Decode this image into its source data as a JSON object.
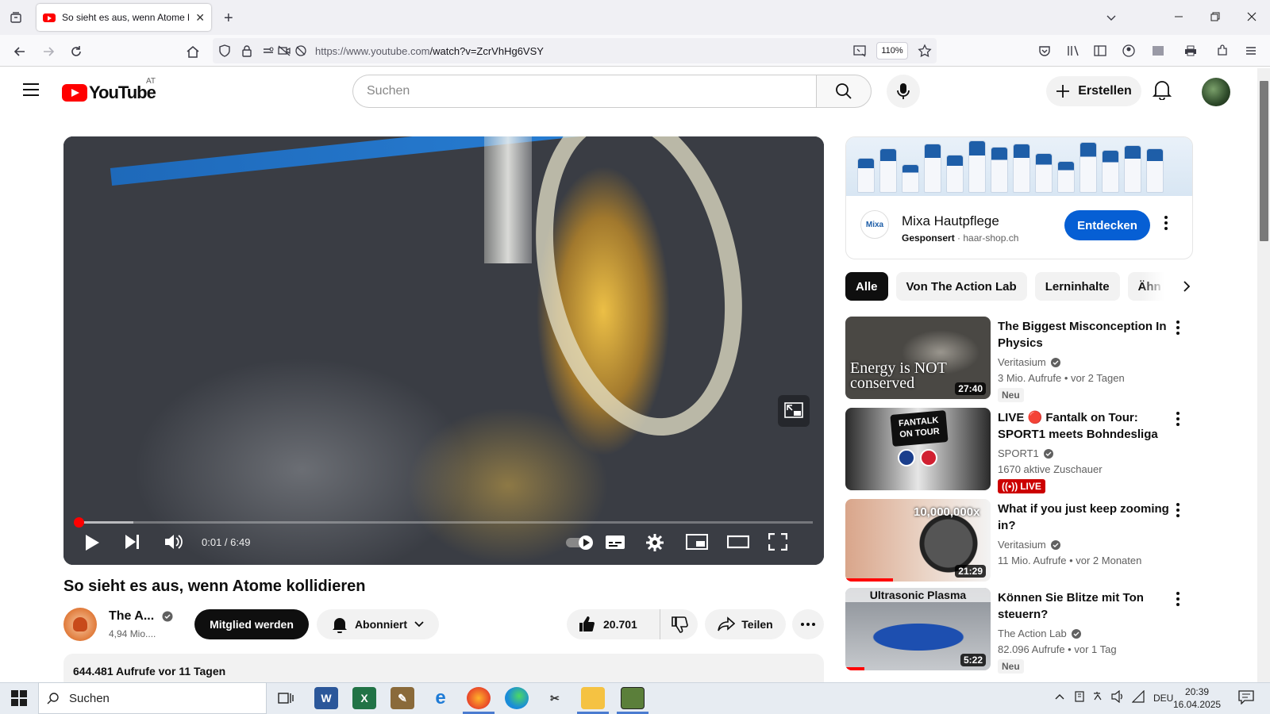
{
  "browser": {
    "tab_title": "So sieht es aus, wenn Atome ko",
    "url_host": "https://www.youtube.com",
    "url_path": "/watch?v=ZcrVhHg6VSY",
    "zoom": "110%"
  },
  "header": {
    "logo_text": "YouTube",
    "country": "AT",
    "search_placeholder": "Suchen",
    "create_label": "Erstellen"
  },
  "player": {
    "time": "0:01 / 6:49",
    "progress_fraction": 0.003,
    "buffered_fraction": 0.08
  },
  "video": {
    "title": "So sieht es aus, wenn Atome kollidieren",
    "channel": "The A...",
    "subscribers": "4,94 Mio....",
    "member_label": "Mitglied werden",
    "subscribed_label": "Abonniert",
    "likes": "20.701",
    "share_label": "Teilen",
    "views_date": "644.481 Aufrufe  vor 11 Tagen"
  },
  "ad": {
    "name": "Mixa Hautpflege",
    "sponsored": "Gesponsert",
    "domain": "haar-shop.ch",
    "cta": "Entdecken",
    "logo_text": "Mixa",
    "accent": "#065fd4"
  },
  "chips": [
    "Alle",
    "Von The Action Lab",
    "Lerninhalte",
    "Ähn"
  ],
  "recommendations": [
    {
      "title": "The Biggest Misconception In Physics",
      "channel": "Veritasium",
      "meta": "3 Mio. Aufrufe  • vor 2 Tagen",
      "badge": "Neu",
      "duration": "27:40",
      "thumb_text": "Energy is NOT conserved"
    },
    {
      "title": "LIVE 🔴 Fantalk on Tour: SPORT1 meets Bohndesliga |...",
      "channel": "SPORT1",
      "meta": "1670 aktive Zuschauer",
      "badge": "LIVE",
      "duration": "",
      "thumb_text": "FANTALK ON TOUR"
    },
    {
      "title": "What if you just keep zooming in?",
      "channel": "Veritasium",
      "meta": "11 Mio. Aufrufe  • vor 2 Monaten",
      "badge": "",
      "duration": "21:29",
      "thumb_text": "10,000,000x"
    },
    {
      "title": "Können Sie Blitze mit Ton steuern?",
      "channel": "The Action Lab",
      "meta": "82.096 Aufrufe  • vor 1 Tag",
      "badge": "Neu",
      "duration": "5:22",
      "thumb_text": "Ultrasonic Plasma"
    }
  ],
  "taskbar": {
    "search_label": "Suchen",
    "language": "DEU",
    "time": "20:39",
    "date": "16.04.2025"
  }
}
